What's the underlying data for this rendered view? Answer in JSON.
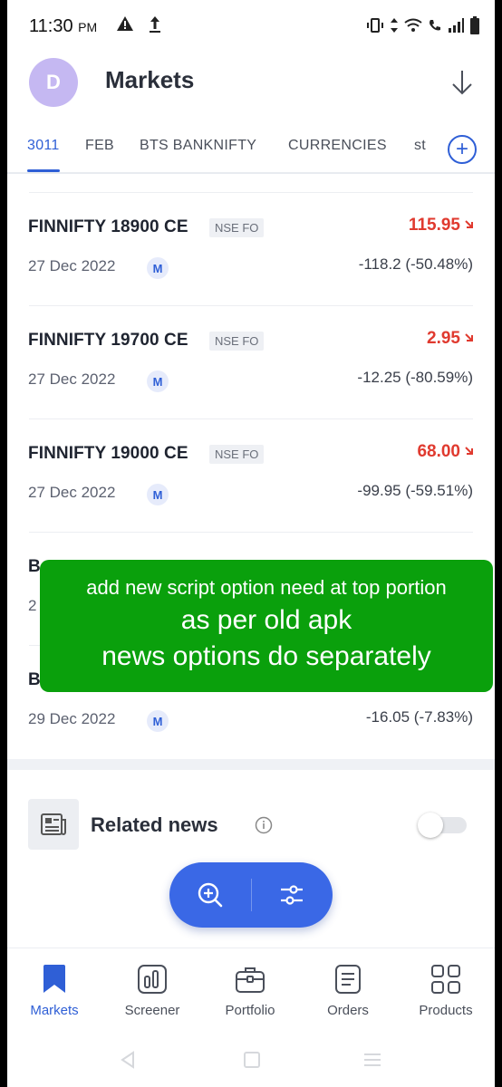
{
  "status_bar": {
    "time": "11:30",
    "ampm": "PM"
  },
  "header": {
    "avatar_letter": "D",
    "title": "Markets"
  },
  "tabs": [
    {
      "label": "3011",
      "active": true
    },
    {
      "label": "FEB",
      "active": false
    },
    {
      "label": "BTS BANKNIFTY",
      "active": false
    },
    {
      "label": "CURRENCIES",
      "active": false
    },
    {
      "label": "st",
      "active": false
    }
  ],
  "instruments": [
    {
      "symbol": "FINNIFTY 18900 CE",
      "exchange": "NSE FO",
      "date": "27 Dec 2022",
      "badge": "M",
      "price": "115.95",
      "change": "-118.2 (-50.48%)"
    },
    {
      "symbol": "FINNIFTY 19700 CE",
      "exchange": "NSE FO",
      "date": "27 Dec 2022",
      "badge": "M",
      "price": "2.95",
      "change": "-12.25 (-80.59%)"
    },
    {
      "symbol": "FINNIFTY 19000 CE",
      "exchange": "NSE FO",
      "date": "27 Dec 2022",
      "badge": "M",
      "price": "68.00",
      "change": "-99.95 (-59.51%)"
    }
  ],
  "partial_rows": [
    {
      "symbol_fragment": "B",
      "date_fragment": "2"
    },
    {
      "symbol_fragment": "B",
      "date": "29 Dec 2022",
      "badge": "M",
      "change": "-16.05 (-7.83%)"
    }
  ],
  "overlay": {
    "line1": "add new script option need at top portion",
    "line2": "as per old apk",
    "line3": "news options do separately"
  },
  "related_news": {
    "label": "Related news",
    "enabled": false
  },
  "bottom_nav": [
    {
      "label": "Markets",
      "active": true
    },
    {
      "label": "Screener",
      "active": false
    },
    {
      "label": "Portfolio",
      "active": false
    },
    {
      "label": "Orders",
      "active": false
    },
    {
      "label": "Products",
      "active": false
    }
  ],
  "colors": {
    "accent": "#2f5fd6",
    "negative": "#e03a2f",
    "overlay": "#0aa00c"
  }
}
